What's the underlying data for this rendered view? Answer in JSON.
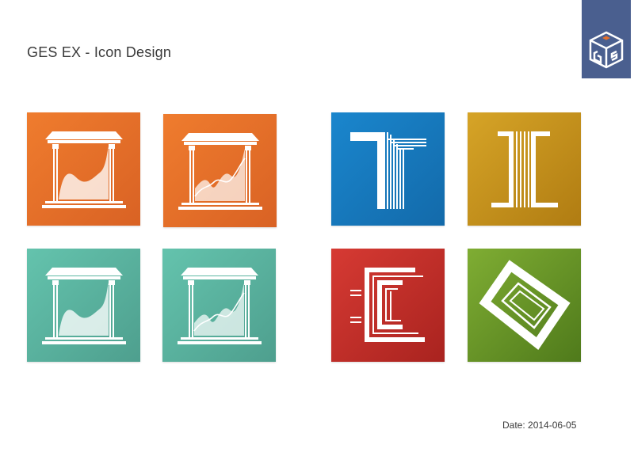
{
  "page": {
    "title": "GES EX - Icon Design",
    "date": "Date: 2014-06-05"
  },
  "logo": {
    "icon": "ges-cube-logo-icon",
    "background": "#4a5f8f"
  },
  "icons": [
    {
      "name": "temple-chart-smooth-orange",
      "icon": "temple-chart-icon",
      "color": "#e6702a"
    },
    {
      "name": "temple-chart-wave-orange",
      "icon": "temple-chart-icon",
      "color": "#e6702a"
    },
    {
      "name": "letter-t-blue",
      "icon": "letter-t-icon",
      "color": "#1779be"
    },
    {
      "name": "letter-i-gold",
      "icon": "letter-i-icon",
      "color": "#c4901d"
    },
    {
      "name": "temple-chart-smooth-teal",
      "icon": "temple-chart-icon",
      "color": "#59b19d"
    },
    {
      "name": "temple-chart-wave-teal",
      "icon": "temple-chart-icon",
      "color": "#59b19d"
    },
    {
      "name": "letter-e-red",
      "icon": "letter-e-icon",
      "color": "#c0302a"
    },
    {
      "name": "letter-s-green",
      "icon": "letter-s-icon",
      "color": "#679427"
    }
  ]
}
